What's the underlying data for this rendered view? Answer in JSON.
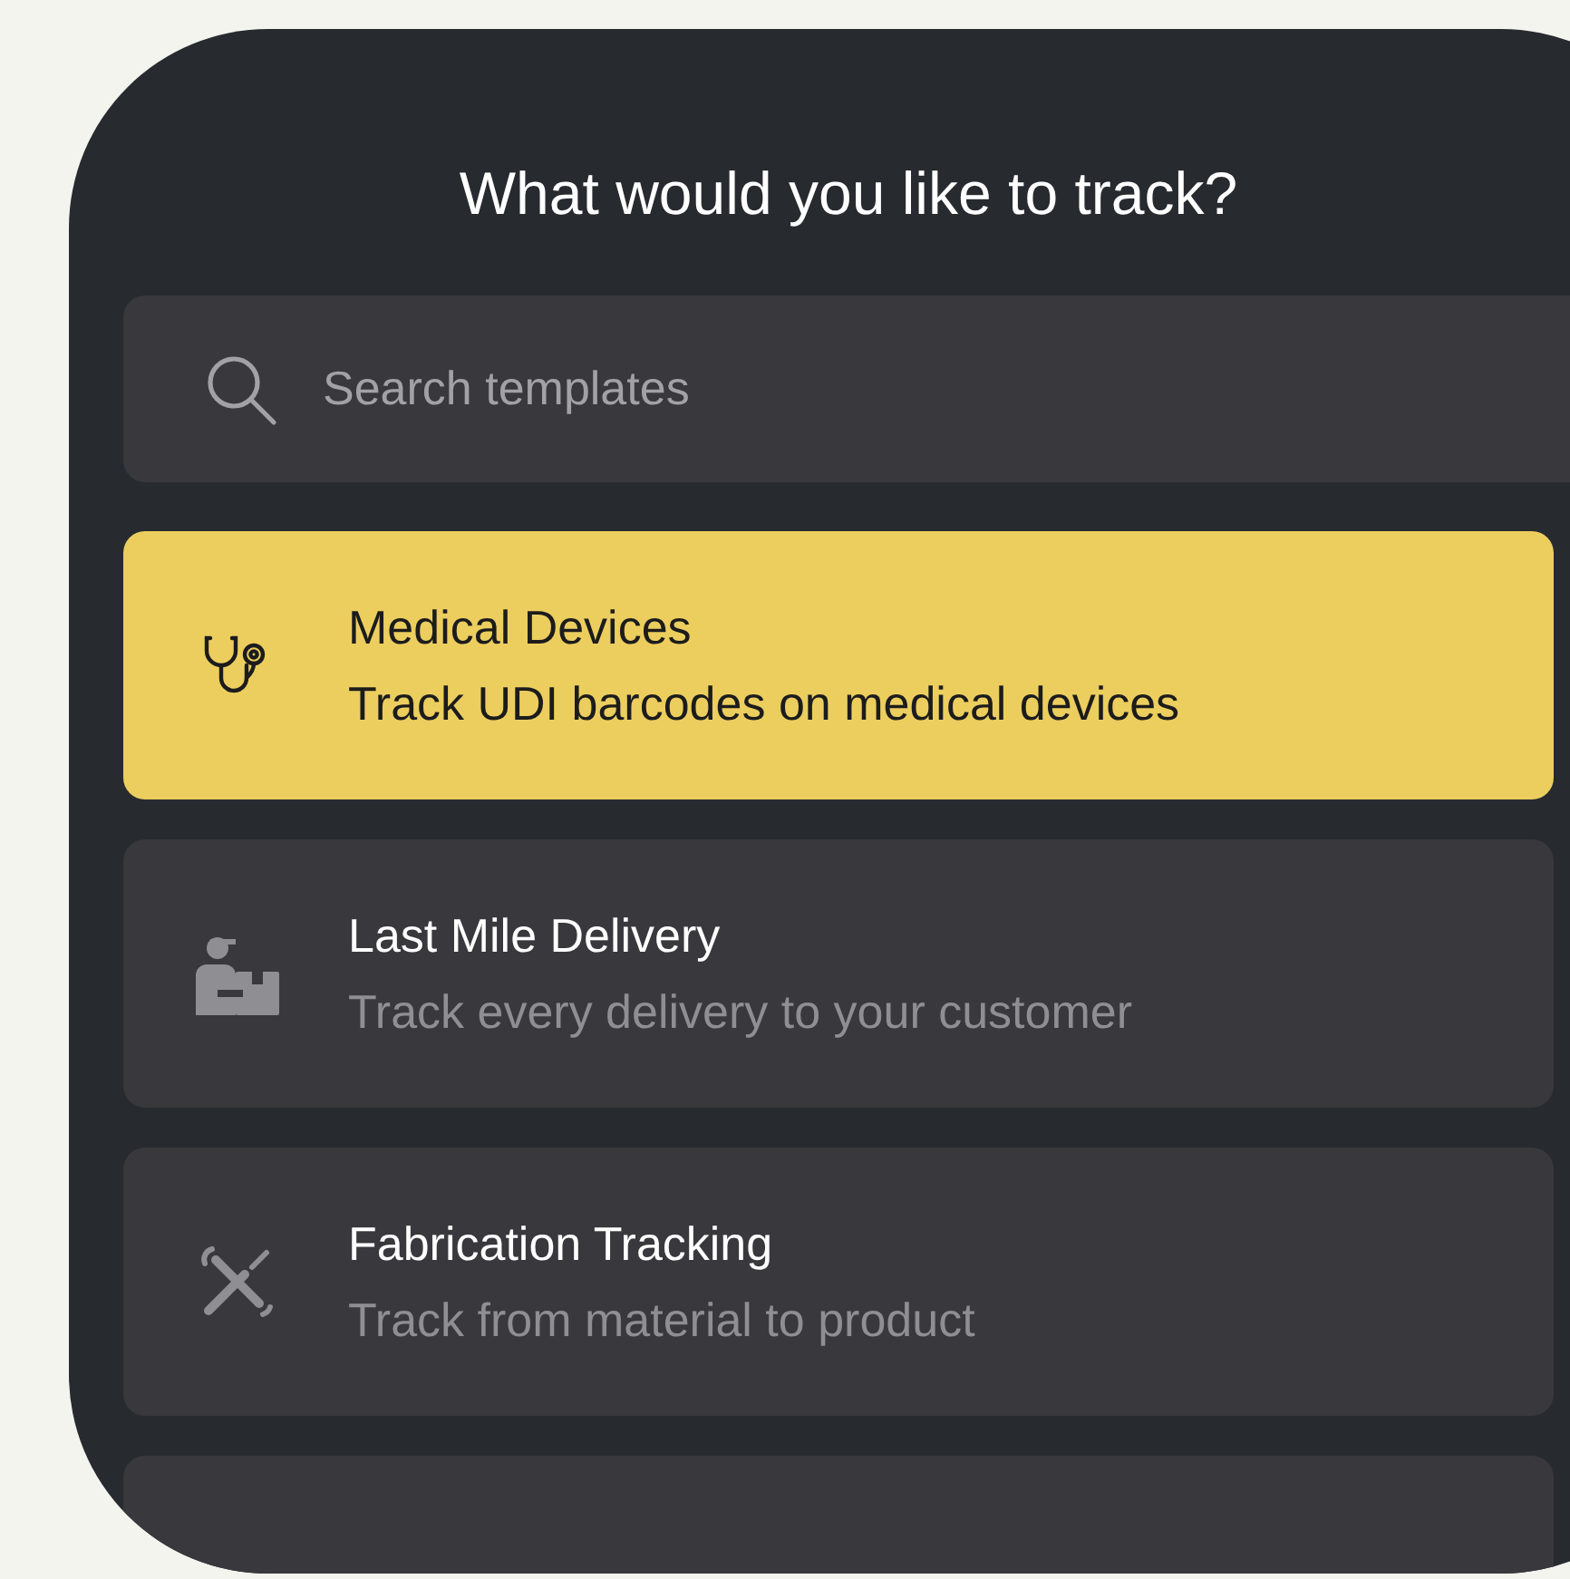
{
  "title": "What would you like to track?",
  "search": {
    "placeholder": "Search templates"
  },
  "templates": [
    {
      "kind": "stethoscope",
      "name": "Medical Devices",
      "description": "Track UDI barcodes on medical devices",
      "selected": true
    },
    {
      "kind": "delivery",
      "name": "Last Mile Delivery",
      "description": "Track every delivery to your customer",
      "selected": false
    },
    {
      "kind": "tools",
      "name": "Fabrication Tracking",
      "description": "Track from material to product",
      "selected": false
    }
  ]
}
